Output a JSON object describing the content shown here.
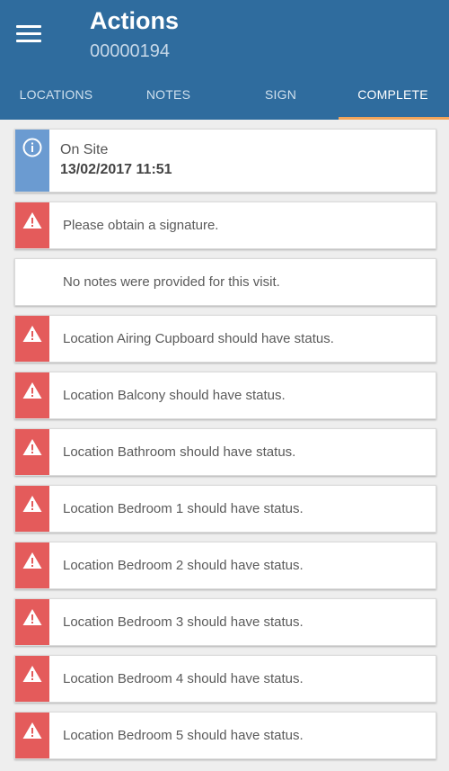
{
  "header": {
    "title": "Actions",
    "subtitle": "00000194"
  },
  "tabs": [
    {
      "label": "LOCATIONS",
      "active": false
    },
    {
      "label": "NOTES",
      "active": false
    },
    {
      "label": "SIGN",
      "active": false
    },
    {
      "label": "COMPLETE",
      "active": true
    }
  ],
  "colors": {
    "appbar": "#2f6c9e",
    "tab_indicator": "#f2a55b",
    "info": "#6b9bd1",
    "error": "#e45b5b",
    "warning": "#f6a048"
  },
  "status_card": {
    "label": "On Site",
    "datetime": "13/02/2017 11:51",
    "icon": "info-icon"
  },
  "items": [
    {
      "type": "error",
      "icon": "warning-triangle-icon",
      "text": "Please obtain a signature."
    },
    {
      "type": "warning",
      "icon": "info-icon",
      "text": "No notes were provided for this visit."
    },
    {
      "type": "error",
      "icon": "warning-triangle-icon",
      "text": "Location Airing Cupboard should have status."
    },
    {
      "type": "error",
      "icon": "warning-triangle-icon",
      "text": "Location Balcony should have status."
    },
    {
      "type": "error",
      "icon": "warning-triangle-icon",
      "text": "Location Bathroom should have status."
    },
    {
      "type": "error",
      "icon": "warning-triangle-icon",
      "text": "Location Bedroom 1 should have status."
    },
    {
      "type": "error",
      "icon": "warning-triangle-icon",
      "text": "Location Bedroom 2 should have status."
    },
    {
      "type": "error",
      "icon": "warning-triangle-icon",
      "text": "Location Bedroom 3 should have status."
    },
    {
      "type": "error",
      "icon": "warning-triangle-icon",
      "text": "Location Bedroom 4 should have status."
    },
    {
      "type": "error",
      "icon": "warning-triangle-icon",
      "text": "Location Bedroom 5 should have status."
    }
  ]
}
